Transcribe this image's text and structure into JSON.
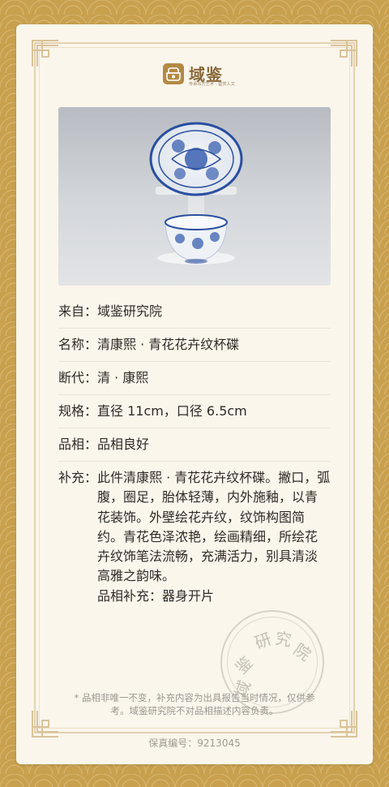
{
  "brand": {
    "name": "域鉴",
    "slogan": "传承东方艺术 · 鉴赏人文",
    "logo_color": "#b38a45"
  },
  "photo": {
    "icon": "porcelain-cup-and-saucer-photo"
  },
  "info": {
    "source": {
      "label": "来自：",
      "value": "域鉴研究院"
    },
    "name": {
      "label": "名称：",
      "value": "清康熙 · 青花花卉纹杯碟"
    },
    "era": {
      "label": "断代：",
      "value": "清 · 康熙"
    },
    "size": {
      "label": "规格：",
      "value": "直径 11cm，口径 6.5cm"
    },
    "condition": {
      "label": "品相：",
      "value": "品相良好"
    },
    "supplement": {
      "label": "补充：",
      "value": "此件清康熙 · 青花花卉纹杯碟。撇口，弧腹，圈足，胎体轻薄，内外施釉，以青花装饰。外壁绘花卉纹，纹饰构图简约。青花色泽浓艳，绘画精细，所绘花卉纹饰笔法流畅，充满活力，别具清淡高雅之韵味。",
      "extra": "品相补充：器身开片"
    }
  },
  "seal": {
    "chars": [
      "研",
      "究",
      "院",
      "鉴",
      "域"
    ]
  },
  "note": "* 品相非唯一不变，补充内容为出具报告当时情况，仅供参考。域鉴研究院不对品相描述内容负责。",
  "footer": {
    "label": "保真编号：",
    "number": "9213045"
  }
}
